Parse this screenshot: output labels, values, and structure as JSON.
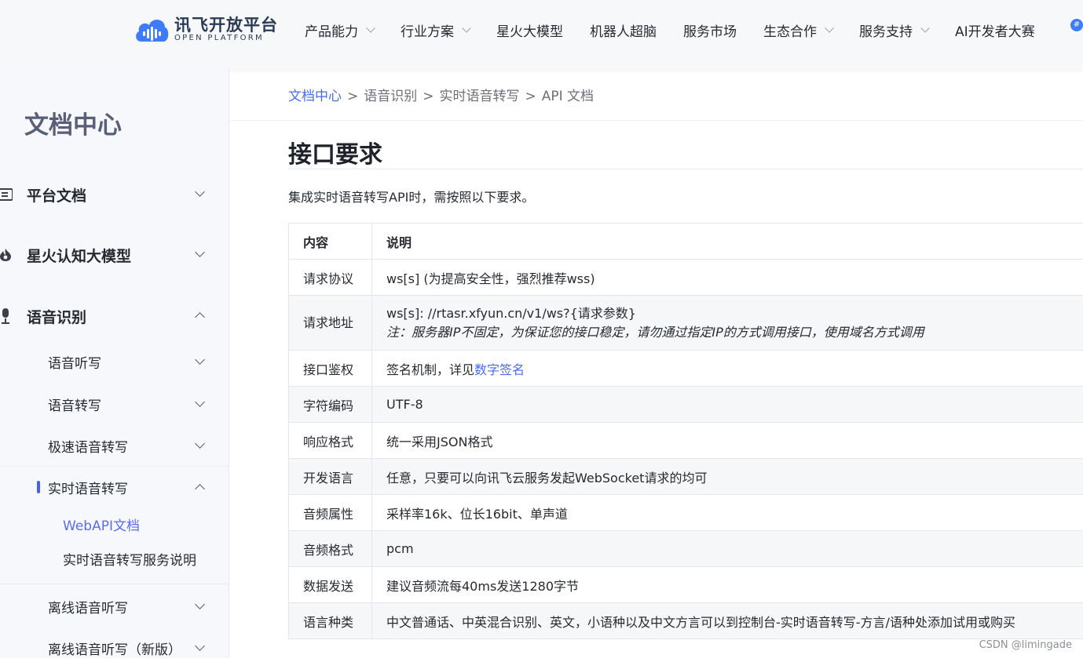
{
  "header": {
    "logo_cn": "讯飞开放平台",
    "logo_en": "OPEN PLATFORM",
    "nav": [
      {
        "label": "产品能力",
        "dropdown": true
      },
      {
        "label": "行业方案",
        "dropdown": true
      },
      {
        "label": "星火大模型",
        "dropdown": false
      },
      {
        "label": "机器人超脑",
        "dropdown": false
      },
      {
        "label": "服务市场",
        "dropdown": false
      },
      {
        "label": "生态合作",
        "dropdown": true
      },
      {
        "label": "服务支持",
        "dropdown": true
      },
      {
        "label": "AI开发者大赛",
        "dropdown": false
      }
    ],
    "badge": "#"
  },
  "sidebar": {
    "title": "文档中心",
    "groups": [
      {
        "label": "平台文档",
        "icon": "document-list-icon",
        "expanded": false
      },
      {
        "label": "星火认知大模型",
        "icon": "spark-icon",
        "expanded": false
      },
      {
        "label": "语音识别",
        "icon": "microphone-icon",
        "expanded": true
      }
    ],
    "subs": [
      {
        "label": "语音听写",
        "expanded": false
      },
      {
        "label": "语音转写",
        "expanded": false
      },
      {
        "label": "极速语音转写",
        "expanded": false
      },
      {
        "label": "实时语音转写",
        "expanded": true
      },
      {
        "label": "离线语音听写",
        "expanded": false
      },
      {
        "label": "离线语音听写（新版）",
        "expanded": false
      }
    ],
    "leaves": [
      {
        "label": "WebAPI文档",
        "active": true
      },
      {
        "label": "实时语音转写服务说明",
        "active": false
      }
    ]
  },
  "breadcrumb": [
    "文档中心",
    "语音识别",
    "实时语音转写",
    "API 文档"
  ],
  "page": {
    "title": "接口要求",
    "intro": "集成实时语音转写API时，需按照以下要求。"
  },
  "table": {
    "headers": [
      "内容",
      "说明"
    ],
    "rows": [
      {
        "name": "请求协议",
        "desc": "ws[s] (为提高安全性，强烈推荐wss)"
      },
      {
        "name": "请求地址",
        "desc": "ws[s]: //rtasr.xfyun.cn/v1/ws?{请求参数}",
        "note": "注：服务器IP不固定，为保证您的接口稳定，请勿通过指定IP的方式调用接口，使用域名方式调用"
      },
      {
        "name": "接口鉴权",
        "desc": "签名机制，详见",
        "link": "数字签名"
      },
      {
        "name": "字符编码",
        "desc": "UTF-8"
      },
      {
        "name": "响应格式",
        "desc": "统一采用JSON格式"
      },
      {
        "name": "开发语言",
        "desc": "任意，只要可以向讯飞云服务发起WebSocket请求的均可"
      },
      {
        "name": "音频属性",
        "desc": "采样率16k、位长16bit、单声道"
      },
      {
        "name": "音频格式",
        "desc": "pcm"
      },
      {
        "name": "数据发送",
        "desc": "建议音频流每40ms发送1280字节"
      },
      {
        "name": "语言种类",
        "desc": "中文普通话、中英混合识别、英文，小语种以及中文方言可以到控制台-实时语音转写-方言/语种处添加试用或购买"
      }
    ]
  },
  "watermark": "CSDN @limingade",
  "colors": {
    "accent": "#4a6cf0",
    "logo": "#3e7bfa",
    "sidebar_bg": "#f6f8fb"
  }
}
